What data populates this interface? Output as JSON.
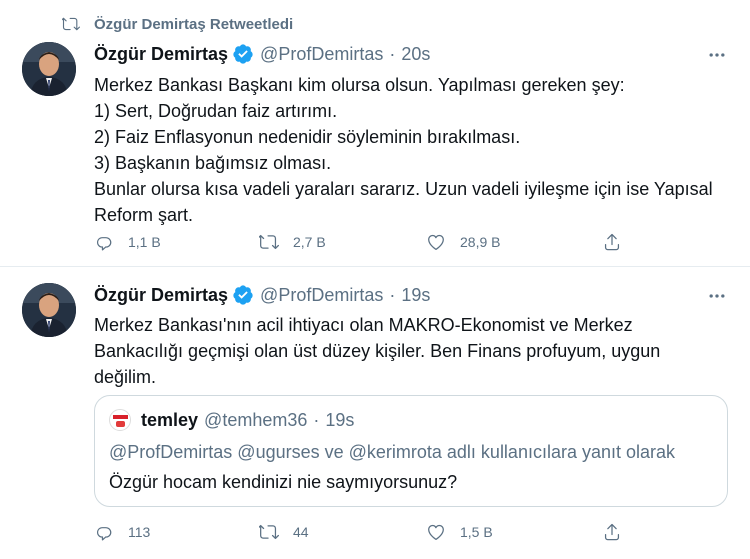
{
  "retweet_banner": {
    "text": "Özgür Demirtaş Retweetledi"
  },
  "tweets": [
    {
      "name": "Özgür Demirtaş",
      "handle": "@ProfDemirtas",
      "dot": "·",
      "time": "20s",
      "lines": [
        "Merkez Bankası Başkanı kim olursa olsun. Yapılması gereken şey:",
        "1) Sert, Doğrudan faiz artırımı.",
        "2) Faiz Enflasyonun nedenidir söyleminin bırakılması.",
        "3) Başkanın bağımsız olması.",
        "Bunlar olursa kısa vadeli yaraları sararız. Uzun vadeli iyileşme için ise Yapısal",
        "Reform şart."
      ],
      "replies": "1,1 B",
      "retweets": "2,7 B",
      "likes": "28,9 B"
    },
    {
      "name": "Özgür Demirtaş",
      "handle": "@ProfDemirtas",
      "dot": "·",
      "time": "19s",
      "lines": [
        "Merkez Bankası'nın acil ihtiyacı olan MAKRO-Ekonomist ve Merkez",
        "Bankacılığı geçmişi olan üst düzey kişiler. Ben Finans profuyum, uygun",
        "değilim."
      ],
      "quote": {
        "name": "temley",
        "handle": "@temhem36",
        "dot": "·",
        "time": "19s",
        "reply_to": "@ProfDemirtas @ugurses ve @kerimrota adlı kullanıcılara yanıt olarak",
        "text": "Özgür hocam kendinizi nie saymıyorsunuz?"
      },
      "replies": "113",
      "retweets": "44",
      "likes": "1,5 B"
    }
  ],
  "colors": {
    "text": "#0f1419",
    "secondary": "#5b7083",
    "verified": "#1da1f2",
    "border": "#e6ecf0"
  },
  "icons": [
    "retweet-icon",
    "verified-icon",
    "more-icon",
    "reply-icon",
    "like-icon",
    "share-icon"
  ]
}
